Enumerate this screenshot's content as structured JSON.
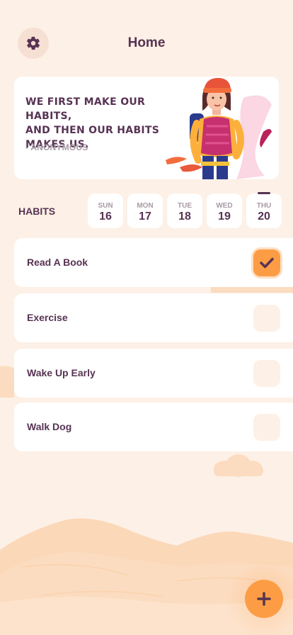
{
  "header": {
    "title": "Home",
    "settings_icon": "gear-icon"
  },
  "quote": {
    "lines": [
      "WE FIRST MAKE OUR HABITS,",
      "AND THEN OUR HABITS",
      "MAKES US."
    ],
    "author": "- ANONYMOUS",
    "illustration": "hiker-girl-illustration"
  },
  "habits_section": {
    "label": "HABITS",
    "days": [
      {
        "name": "SUN",
        "num": "16",
        "selected": false
      },
      {
        "name": "MON",
        "num": "17",
        "selected": false
      },
      {
        "name": "TUE",
        "num": "18",
        "selected": false
      },
      {
        "name": "WED",
        "num": "19",
        "selected": false
      },
      {
        "name": "THU",
        "num": "20",
        "selected": true
      }
    ]
  },
  "habits": [
    {
      "name": "Read A Book",
      "done": true
    },
    {
      "name": "Exercise",
      "done": false
    },
    {
      "name": "Wake Up Early",
      "done": false
    },
    {
      "name": "Walk Dog",
      "done": false
    }
  ],
  "fab": {
    "icon": "plus-icon"
  },
  "colors": {
    "background": "#fdf0e6",
    "primary_text": "#573353",
    "accent": "#fc9d45",
    "muted_text": "#a89aa6"
  }
}
